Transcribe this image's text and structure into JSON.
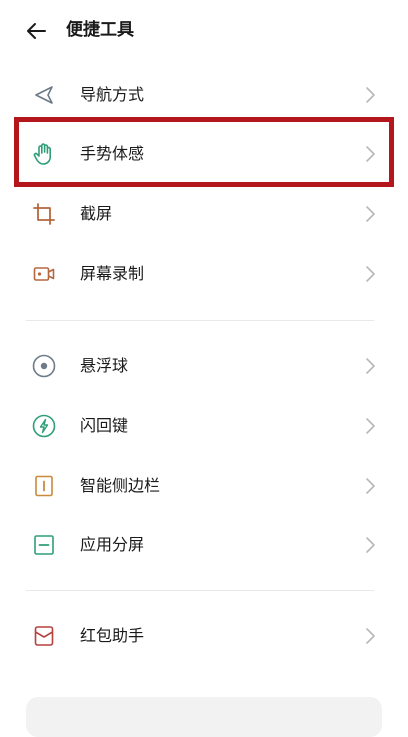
{
  "header": {
    "title": "便捷工具"
  },
  "items": [
    {
      "label": "导航方式"
    },
    {
      "label": "手势体感"
    },
    {
      "label": "截屏"
    },
    {
      "label": "屏幕录制"
    },
    {
      "label": "悬浮球"
    },
    {
      "label": "闪回键"
    },
    {
      "label": "智能侧边栏"
    },
    {
      "label": "应用分屏"
    },
    {
      "label": "红包助手"
    }
  ],
  "icons": {
    "navigation": "navigation-arrow-icon",
    "gesture": "hand-icon",
    "screenshot": "crop-icon",
    "record": "video-camera-icon",
    "float_ball": "floating-ball-icon",
    "flash_key": "lightning-icon",
    "sidebar": "sidebar-icon",
    "split": "split-screen-icon",
    "red_packet": "envelope-icon"
  },
  "colors": {
    "highlight": "#b3171b",
    "icon_green": "#2f9e78",
    "icon_brown": "#b5673f",
    "icon_gray": "#6d7a88"
  }
}
